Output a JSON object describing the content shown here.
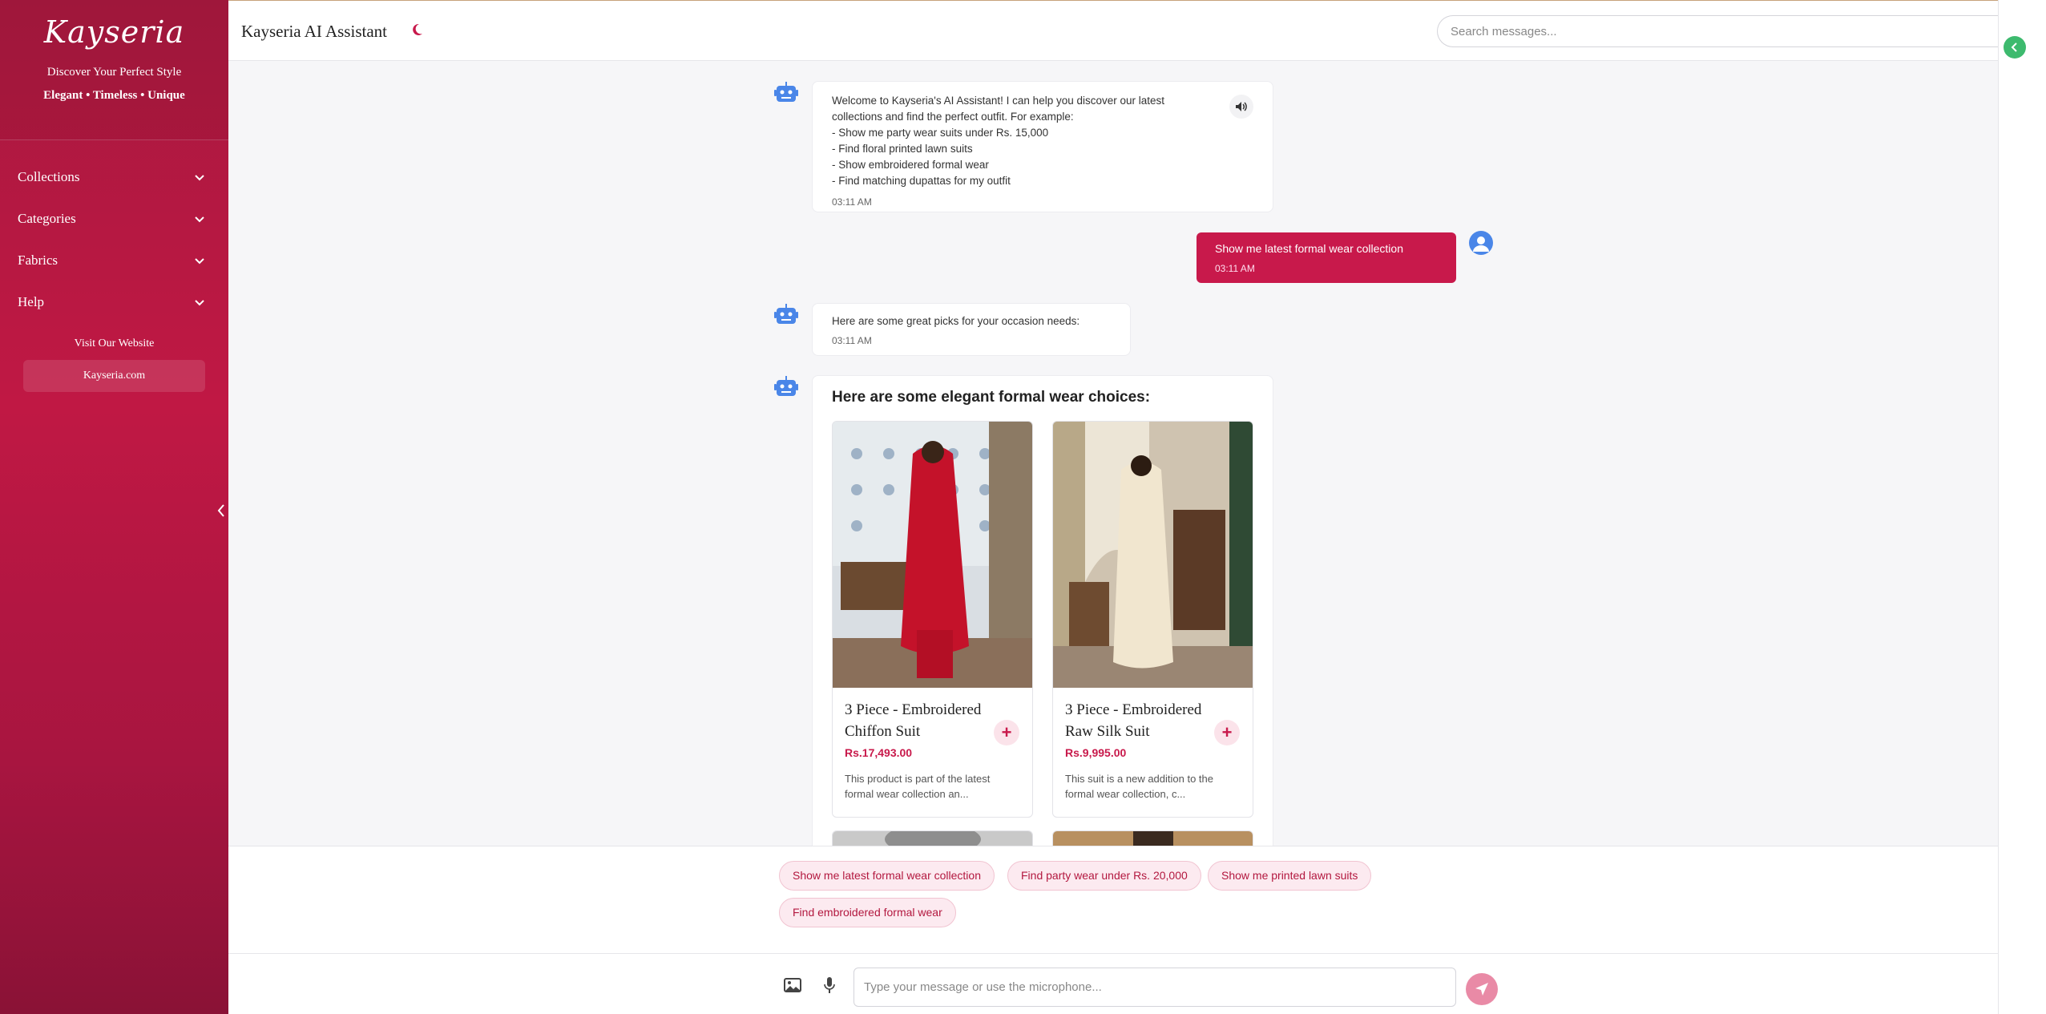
{
  "sidebar": {
    "logo": "Kayseria",
    "tagline": "Discover Your Perfect Style",
    "subtagline": "Elegant • Timeless • Unique",
    "nav": [
      {
        "label": "Collections"
      },
      {
        "label": "Categories"
      },
      {
        "label": "Fabrics"
      },
      {
        "label": "Help"
      }
    ],
    "visit_label": "Visit Our Website",
    "site_button": "Kayseria.com"
  },
  "header": {
    "title": "Kayseria AI Assistant",
    "search_placeholder": "Search messages..."
  },
  "messages": {
    "welcome": {
      "lines": [
        "Welcome to Kayseria's AI Assistant! I can help you discover our latest",
        "collections and find the perfect outfit. For example:",
        "- Show me party wear suits under Rs. 15,000",
        "- Find floral printed lawn suits",
        "- Show embroidered formal wear",
        "- Find matching dupattas for my outfit"
      ],
      "time": "03:11 AM"
    },
    "user": {
      "text": "Show me latest formal wear collection",
      "time": "03:11 AM"
    },
    "reply": {
      "text": "Here are some great picks for your occasion needs:",
      "time": "03:11 AM"
    },
    "products": {
      "heading": "Here are some elegant formal wear choices:",
      "items": [
        {
          "title": "3 Piece - Embroidered Chiffon Suit",
          "price": "Rs.17,493.00",
          "desc": "This product is part of the latest formal wear collection an..."
        },
        {
          "title": "3 Piece - Embroidered Raw Silk Suit",
          "price": "Rs.9,995.00",
          "desc": "This suit is a new addition to the formal wear collection, c..."
        }
      ]
    }
  },
  "suggestions": [
    "Show me latest formal wear collection",
    "Find party wear under Rs. 20,000",
    "Show me printed lawn suits",
    "Find embroidered formal wear"
  ],
  "input": {
    "placeholder": "Type your message or use the microphone..."
  },
  "colors": {
    "brand": "#c01844",
    "accent_bot": "#4a86e8",
    "status_green": "#3dba6e"
  }
}
